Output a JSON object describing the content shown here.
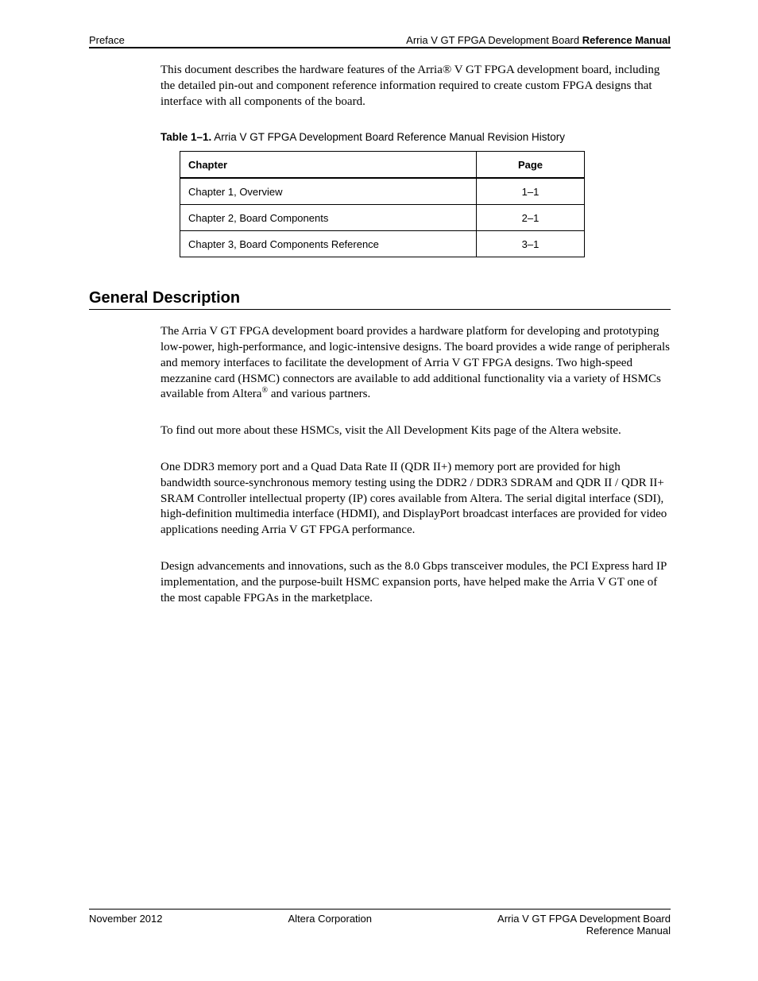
{
  "header": {
    "left": "Preface",
    "right_prefix": "Arria V GT FPGA Development Board ",
    "right_bold": "Reference Manual"
  },
  "intro_para": "This document describes the hardware features of the Arria® V GT FPGA development board, including the detailed pin-out and component reference information required to create custom FPGA designs that interface with all components of the board.",
  "table": {
    "caption_number": "Table 1–1.",
    "caption_text": " Arria V GT FPGA Development Board Reference Manual Revision History",
    "headers": {
      "col1": "Chapter",
      "col2": "Page"
    },
    "rows": [
      {
        "chapter": "Chapter 1, Overview",
        "page": "1–1"
      },
      {
        "chapter": "Chapter 2, Board Components",
        "page": "2–1"
      },
      {
        "chapter": "Chapter 3, Board Components Reference",
        "page": "3–1"
      }
    ]
  },
  "section": {
    "heading": "General Description",
    "p1_pre": "The Arria V GT FPGA development board provides a hardware platform for developing and prototyping low-power, high-performance, and logic-intensive designs. The board provides a wide range of peripherals and memory interfaces to facilitate the development of Arria V GT FPGA designs. Two high-speed mezzanine card (HSMC) connectors are available to add additional functionality via a variety of HSMCs available from Altera",
    "p1_ms_sup": "®",
    "p1_post": " and various partners.",
    "link_note": "To find out more about these HSMCs, visit the All Development Kits page of the Altera website.",
    "p2": "One DDR3 memory port and a Quad Data Rate II (QDR II+) memory port are provided for high bandwidth source-synchronous memory testing using the DDR2 / DDR3 SDRAM and QDR II / QDR II+ SRAM Controller intellectual property (IP) cores available from Altera. The serial digital interface (SDI), high-definition multimedia interface (HDMI), and DisplayPort broadcast interfaces are provided for video applications needing Arria V GT FPGA performance.",
    "p3": "Design advancements and innovations, such as the 8.0 Gbps transceiver modules, the PCI Express hard IP implementation, and the purpose-built HSMC expansion ports, have helped make the Arria V GT one of the most capable FPGAs in the marketplace."
  },
  "footer": {
    "left": "November 2012",
    "center": "Altera Corporation",
    "right_prefix": "Arria V GT FPGA Development Board",
    "right_line2": "Reference Manual"
  }
}
